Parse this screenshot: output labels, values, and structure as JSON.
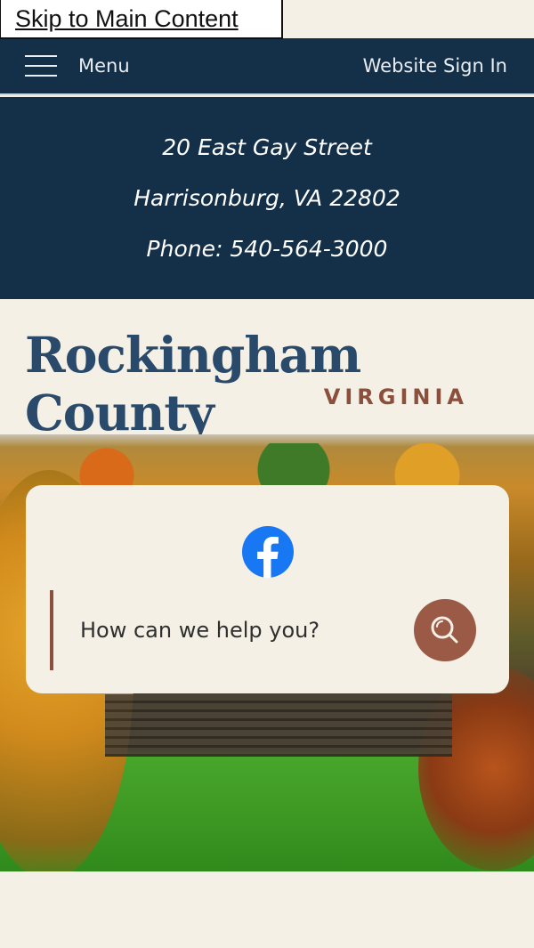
{
  "skip_link": "Skip to Main Content",
  "topbar": {
    "menu_label": "Menu",
    "signin_label": "Website Sign In"
  },
  "contact": {
    "address_line1": "20 East Gay Street",
    "address_line2": "Harrisonburg, VA 22802",
    "phone": "Phone: 540-564-3000"
  },
  "logo": {
    "title": "Rockingham County",
    "subtitle": "VIRGINIA"
  },
  "search": {
    "placeholder": "How can we help you?"
  },
  "social": {
    "facebook_icon": "facebook-icon"
  },
  "colors": {
    "navy": "#142f48",
    "cream": "#f4f0e6",
    "brick": "#8b4f3c",
    "logo_blue": "#2a4a6b",
    "facebook_blue": "#1877f2"
  }
}
